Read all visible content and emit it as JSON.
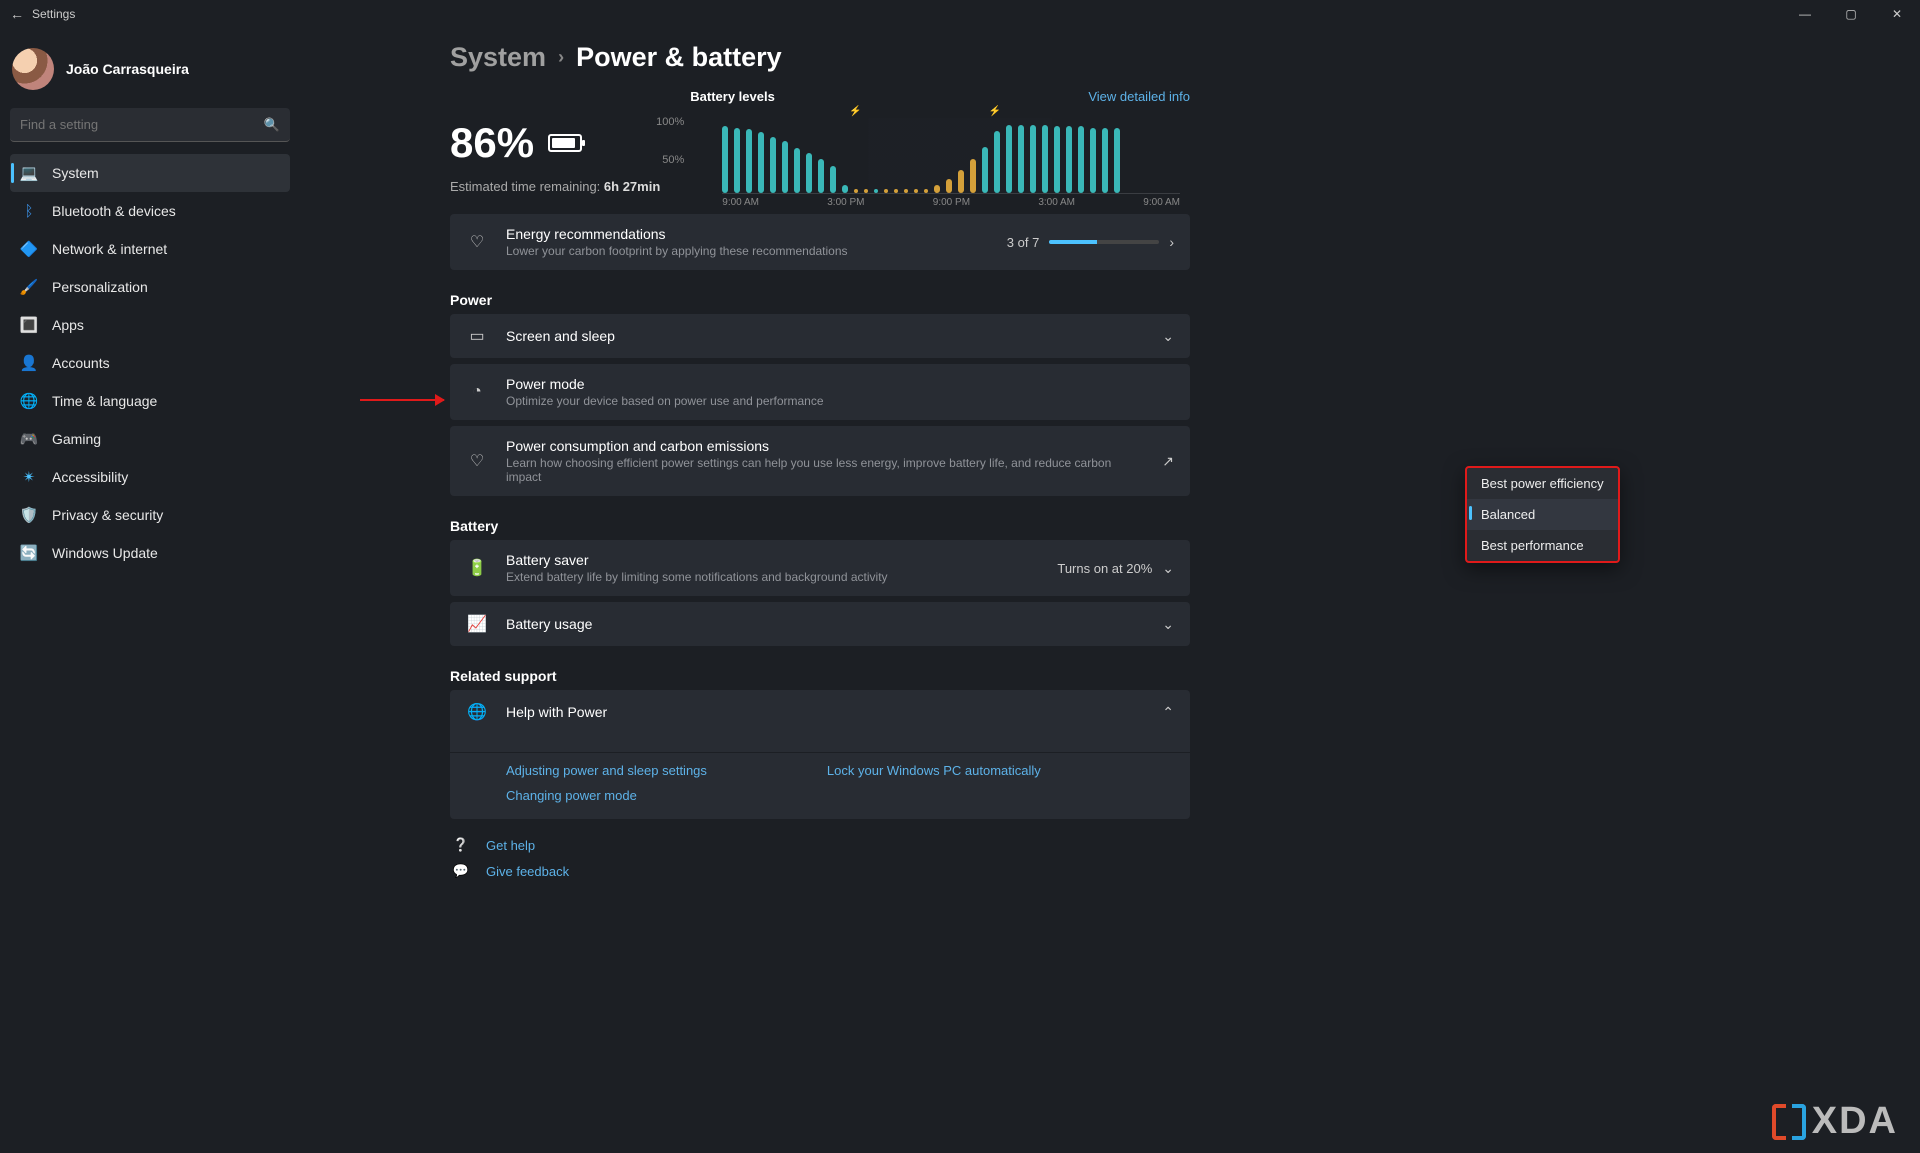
{
  "app_title": "Settings",
  "window": {
    "minimize": "—",
    "maximize": "▢",
    "close": "✕"
  },
  "user": {
    "name": "João Carrasqueira"
  },
  "search": {
    "placeholder": "Find a setting"
  },
  "nav": [
    {
      "icon": "💻",
      "label": "System",
      "selected": true
    },
    {
      "icon": "ᛒ",
      "label": "Bluetooth & devices",
      "color": "#3a8de0"
    },
    {
      "icon": "🔷",
      "label": "Network & internet"
    },
    {
      "icon": "🖌️",
      "label": "Personalization"
    },
    {
      "icon": "🔳",
      "label": "Apps"
    },
    {
      "icon": "👤",
      "label": "Accounts",
      "color": "#44c07a"
    },
    {
      "icon": "🌐",
      "label": "Time & language"
    },
    {
      "icon": "🎮",
      "label": "Gaming"
    },
    {
      "icon": "✴",
      "label": "Accessibility",
      "color": "#4cc2ff"
    },
    {
      "icon": "🛡️",
      "label": "Privacy & security"
    },
    {
      "icon": "🔄",
      "label": "Windows Update",
      "color": "#4cc2ff"
    }
  ],
  "breadcrumb": {
    "root": "System",
    "sep": "›",
    "leaf": "Power & battery"
  },
  "battery": {
    "percent": "86%",
    "estimate_label": "Estimated time remaining:",
    "estimate_value": "6h 27min"
  },
  "chart": {
    "title": "Battery levels",
    "link": "View detailed info"
  },
  "chart_data": {
    "type": "bar",
    "title": "Battery levels",
    "ylabel": "%",
    "ylim": [
      0,
      100
    ],
    "yticks": [
      50,
      100
    ],
    "x_ticks": [
      "9:00 AM",
      "3:00 PM",
      "9:00 PM",
      "3:00 AM",
      "9:00 AM"
    ],
    "markers": [
      {
        "icon": "charging",
        "position_fraction": 0.34
      },
      {
        "icon": "charging",
        "position_fraction": 0.63
      }
    ],
    "series": [
      {
        "name": "battery",
        "values": [
          {
            "h": 88,
            "c": "teal"
          },
          {
            "h": 86,
            "c": "teal"
          },
          {
            "h": 84,
            "c": "teal"
          },
          {
            "h": 80,
            "c": "teal"
          },
          {
            "h": 74,
            "c": "teal"
          },
          {
            "h": 68,
            "c": "teal"
          },
          {
            "h": 59,
            "c": "teal"
          },
          {
            "h": 52,
            "c": "teal"
          },
          {
            "h": 45,
            "c": "teal"
          },
          {
            "h": 36,
            "c": "teal"
          },
          {
            "h": 10,
            "c": "teal"
          },
          {
            "h": 6,
            "c": "amber"
          },
          {
            "h": 6,
            "c": "amber"
          },
          {
            "h": 6,
            "c": "teal"
          },
          {
            "h": 6,
            "c": "amber"
          },
          {
            "h": 6,
            "c": "amber"
          },
          {
            "h": 6,
            "c": "amber"
          },
          {
            "h": 6,
            "c": "amber"
          },
          {
            "h": 8,
            "c": "amber"
          },
          {
            "h": 10,
            "c": "amber"
          },
          {
            "h": 18,
            "c": "amber"
          },
          {
            "h": 30,
            "c": "amber"
          },
          {
            "h": 45,
            "c": "amber"
          },
          {
            "h": 60,
            "c": "teal"
          },
          {
            "h": 82,
            "c": "teal"
          },
          {
            "h": 90,
            "c": "teal"
          },
          {
            "h": 90,
            "c": "teal"
          },
          {
            "h": 90,
            "c": "teal"
          },
          {
            "h": 90,
            "c": "teal"
          },
          {
            "h": 88,
            "c": "teal"
          },
          {
            "h": 88,
            "c": "teal"
          },
          {
            "h": 88,
            "c": "teal"
          },
          {
            "h": 86,
            "c": "teal"
          },
          {
            "h": 86,
            "c": "teal"
          },
          {
            "h": 86,
            "c": "teal"
          }
        ]
      }
    ]
  },
  "cards": {
    "energy": {
      "title": "Energy recommendations",
      "sub": "Lower your carbon footprint by applying these recommendations",
      "count": "3 of 7"
    },
    "power_section": "Power",
    "screen_sleep": {
      "title": "Screen and sleep"
    },
    "power_mode": {
      "title": "Power mode",
      "sub": "Optimize your device based on power use and performance"
    },
    "carbon": {
      "title": "Power consumption and carbon emissions",
      "sub": "Learn how choosing efficient power settings can help you use less energy, improve battery life, and reduce carbon impact"
    },
    "battery_section": "Battery",
    "saver": {
      "title": "Battery saver",
      "sub": "Extend battery life by limiting some notifications and background activity",
      "right": "Turns on at 20%"
    },
    "usage": {
      "title": "Battery usage"
    },
    "related_support": "Related support",
    "help": {
      "title": "Help with Power"
    },
    "help_links": {
      "adjust": "Adjusting power and sleep settings",
      "change": "Changing power mode",
      "lock": "Lock your Windows PC automatically"
    }
  },
  "footer": {
    "get_help": "Get help",
    "feedback": "Give feedback"
  },
  "dropdown": {
    "items": [
      {
        "label": "Best power efficiency"
      },
      {
        "label": "Balanced",
        "selected": true
      },
      {
        "label": "Best performance"
      }
    ]
  },
  "watermark": "XDA"
}
